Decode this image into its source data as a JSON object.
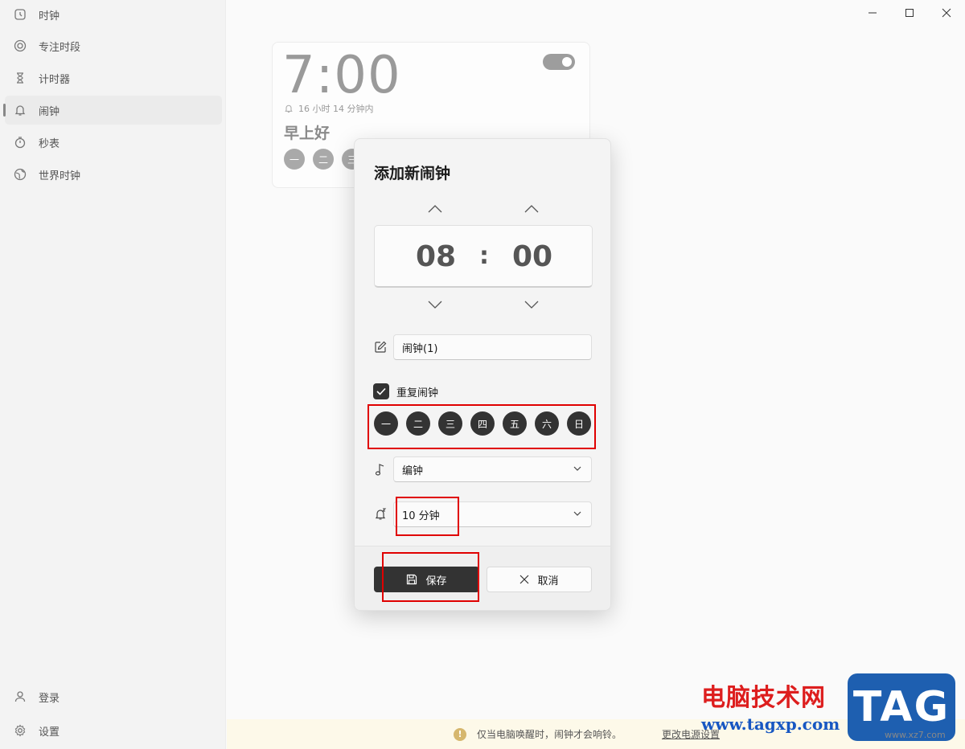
{
  "sidebar": {
    "items": [
      {
        "label": "时钟",
        "icon": "clock-icon"
      },
      {
        "label": "专注时段",
        "icon": "focus-icon"
      },
      {
        "label": "计时器",
        "icon": "hourglass-icon"
      },
      {
        "label": "闹钟",
        "icon": "bell-icon"
      },
      {
        "label": "秒表",
        "icon": "stopwatch-icon"
      },
      {
        "label": "世界时钟",
        "icon": "globe-icon"
      }
    ],
    "bottom": [
      {
        "label": "登录",
        "icon": "person-icon"
      },
      {
        "label": "设置",
        "icon": "gear-icon"
      }
    ]
  },
  "alarm_card": {
    "time": "7:00",
    "remaining": "16 小时 14 分钟内",
    "name": "早上好",
    "days": [
      "一",
      "二",
      "三"
    ]
  },
  "dialog": {
    "title": "添加新闹钟",
    "hour": "08",
    "colon": ":",
    "minute": "00",
    "name_value": "闹钟(1)",
    "repeat_label": "重复闹钟",
    "days": [
      "一",
      "二",
      "三",
      "四",
      "五",
      "六",
      "日"
    ],
    "sound": "编钟",
    "snooze": "10 分钟",
    "save_label": "保存",
    "cancel_label": "取消"
  },
  "banner": {
    "icon": "!",
    "text": "仅当电脑唤醒时，闹钟才会响铃。",
    "link": "更改电源设置"
  },
  "watermark": {
    "site_cn": "电脑技术网",
    "site_url": "www.tagxp.com",
    "logo": "TAG",
    "small": "www.xz7.com"
  },
  "colors": {
    "accent": "#333333",
    "highlight": "#e00000",
    "banner_bg": "#fdf9e9"
  }
}
